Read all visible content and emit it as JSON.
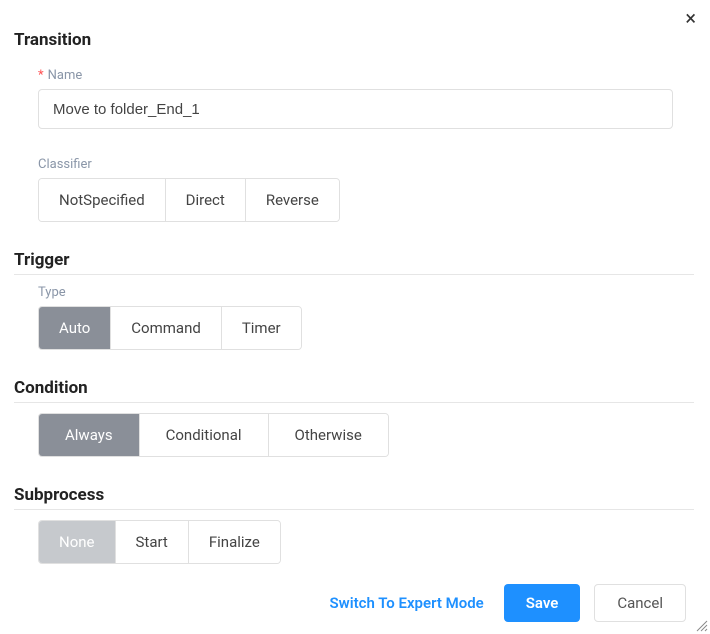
{
  "dialog": {
    "title": "Transition",
    "close_icon": "×"
  },
  "name": {
    "label": "Name",
    "required_mark": "*",
    "value": "Move to folder_End_1"
  },
  "classifier": {
    "label": "Classifier",
    "options": [
      "NotSpecified",
      "Direct",
      "Reverse"
    ],
    "selected": null
  },
  "trigger": {
    "title": "Trigger",
    "type_label": "Type",
    "options": [
      "Auto",
      "Command",
      "Timer"
    ],
    "selected": "Auto"
  },
  "condition": {
    "title": "Condition",
    "options": [
      "Always",
      "Conditional",
      "Otherwise"
    ],
    "selected": "Always"
  },
  "subprocess": {
    "title": "Subprocess",
    "options": [
      "None",
      "Start",
      "Finalize"
    ],
    "selected": "None"
  },
  "footer": {
    "expert": "Switch To Expert Mode",
    "save": "Save",
    "cancel": "Cancel"
  }
}
